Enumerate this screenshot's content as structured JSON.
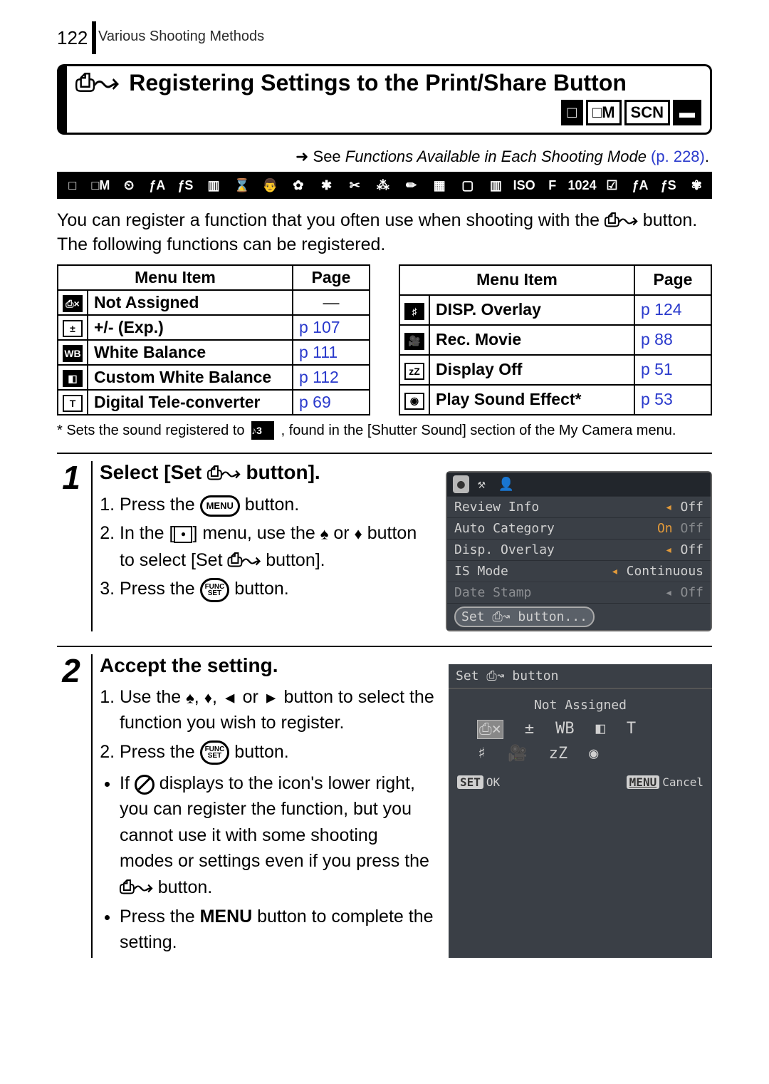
{
  "header": {
    "page_number": "122",
    "section": "Various Shooting Methods"
  },
  "section": {
    "icon_label": "⎙↝",
    "title": "Registering Settings to the Print/Share Button",
    "mode_indicators": [
      "□",
      "□M",
      "SCN",
      "▬"
    ]
  },
  "see_ref": {
    "prefix": "See ",
    "italic": "Functions Available in Each Shooting Mode",
    "link": " (p. 228)",
    "dot": "."
  },
  "icon_strip": [
    "□",
    "□M",
    "⏲",
    "ƒA",
    "ƒS",
    "▥",
    "⌛",
    "👨",
    "✿",
    "✱",
    "✂",
    "⁂",
    "✏",
    "▦",
    "▢",
    "▥",
    "ISO",
    "F",
    "1024",
    "☑",
    "ƒA",
    "ƒS",
    "✾"
  ],
  "intro_part1": "You can register a function that you often use when shooting with the ",
  "intro_icon": "⎙↝",
  "intro_part2": " button. The following functions can be registered.",
  "table_left": {
    "headers": [
      "Menu Item",
      "Page"
    ],
    "rows": [
      {
        "icon": "⎙×",
        "outline": false,
        "name": "Not Assigned",
        "page": "—",
        "link": false
      },
      {
        "icon": "±",
        "outline": true,
        "name": "+/- (Exp.)",
        "page": "p 107",
        "link": true
      },
      {
        "icon": "WB",
        "outline": false,
        "name": "White Balance",
        "page": "p 111",
        "link": true
      },
      {
        "icon": "◧",
        "outline": false,
        "name": "Custom White Balance",
        "page": "p 112",
        "link": true
      },
      {
        "icon": "T",
        "outline": true,
        "name": "Digital Tele-converter",
        "page": "p 69",
        "link": true
      }
    ]
  },
  "table_right": {
    "headers": [
      "Menu Item",
      "Page"
    ],
    "rows": [
      {
        "icon": "♯",
        "outline": false,
        "name": "DISP. Overlay",
        "page": "p 124",
        "link": true
      },
      {
        "icon": "🎥",
        "outline": false,
        "name": "Rec. Movie",
        "page": "p 88",
        "link": true
      },
      {
        "icon": "zZ",
        "outline": true,
        "name": "Display Off",
        "page": "p 51",
        "link": true
      },
      {
        "icon": "◉",
        "outline": true,
        "name": "Play Sound Effect*",
        "page": "p 53",
        "link": true
      }
    ]
  },
  "footnote": {
    "text1": "* Sets the sound registered to ",
    "icon": "♪3",
    "text2": " , found in the [Shutter Sound] section of the My Camera menu."
  },
  "step1": {
    "number": "1",
    "title_pre": "Select [Set ",
    "title_icon": "⎙↝",
    "title_post": " button].",
    "sub1_a": "Press the ",
    "sub1_btn": "MENU",
    "sub1_b": " button.",
    "sub2_a": "In the [",
    "sub2_icon": "●",
    "sub2_b": "] menu, use the ",
    "sub2_c": " or ",
    "sub2_d": " button to select [Set ",
    "sub2_e": " button].",
    "sub3_a": "Press the ",
    "sub3_btn_top": "FUNC",
    "sub3_btn_bot": "SET",
    "sub3_b": " button.",
    "lcd": {
      "tab_icons": [
        "●",
        "⚒",
        "👤"
      ],
      "rows": [
        {
          "label": "Review Info",
          "value": "Off",
          "caret": true
        },
        {
          "label": "Auto Category",
          "value": "On",
          "off": "Off"
        },
        {
          "label": "Disp. Overlay",
          "value": "Off",
          "caret": true
        },
        {
          "label": "IS Mode",
          "value": "Continuous",
          "caret": true
        },
        {
          "label": "Date Stamp",
          "value": "Off",
          "caret": true,
          "dim": true
        }
      ],
      "highlight": "Set ⎙↝ button..."
    }
  },
  "step2": {
    "number": "2",
    "title": "Accept the setting.",
    "sub1_a": "Use the ",
    "sub1_b": ", ",
    "sub1_c": ", ",
    "sub1_d": " or ",
    "sub1_e": " button to select the function you wish to register.",
    "sub2_a": "Press the ",
    "sub2_btn_top": "FUNC",
    "sub2_btn_bot": "SET",
    "sub2_b": " button.",
    "bullet1_a": "If ",
    "bullet1_b": " displays to the icon's lower right, you can register the function, but you cannot use it with some shooting modes or settings even if you press the ",
    "bullet1_c": " button.",
    "bullet2_a": "Press the ",
    "bullet2_menu": "MENU",
    "bullet2_b": " button to complete the setting.",
    "lcd": {
      "title": "Set ⎙↝ button",
      "current": "Not Assigned",
      "icons_row1": [
        "⎙×",
        "±",
        "WB",
        "◧",
        "T"
      ],
      "icons_row2": [
        "♯",
        "🎥",
        "zZ",
        "◉"
      ],
      "ok_label": "SET",
      "ok_text": "OK",
      "cancel_label": "MENU",
      "cancel_text": "Cancel"
    }
  }
}
